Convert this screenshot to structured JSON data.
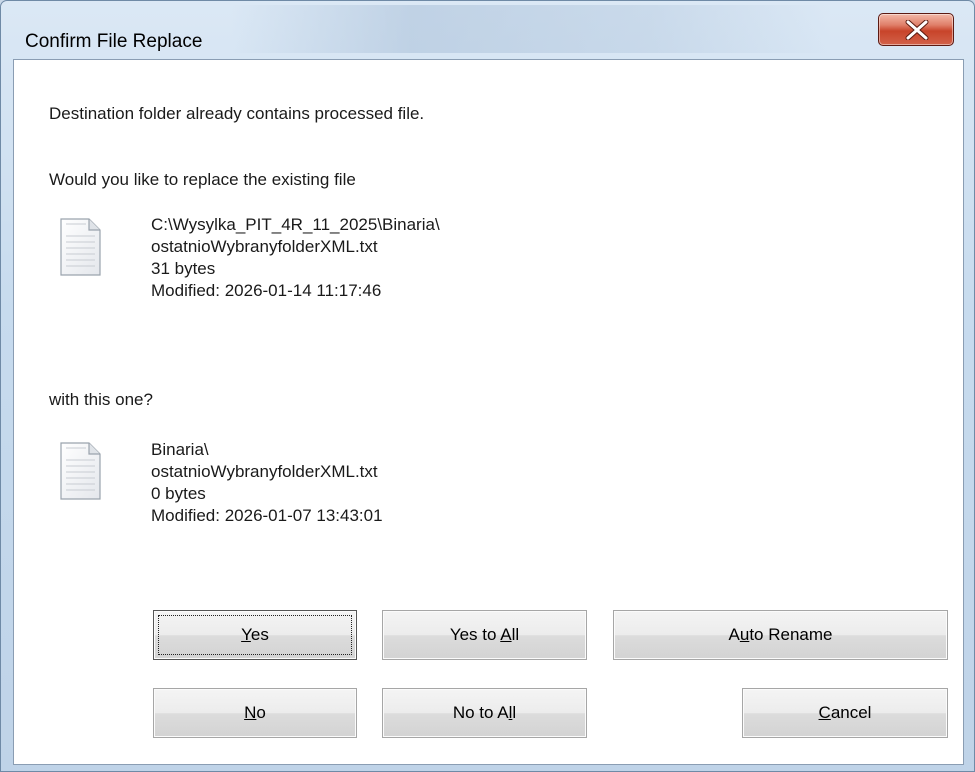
{
  "window": {
    "title": "Confirm File Replace"
  },
  "message": {
    "line1": "Destination folder already contains processed file.",
    "line2": "Would you like to replace the existing file",
    "line3": "with this one?"
  },
  "existing_file": {
    "path": "C:\\Wysylka_PIT_4R_11_2025\\Binaria\\",
    "name": "ostatnioWybranyfolderXML.txt",
    "size": "31 bytes",
    "modified": "Modified: 2026-01-14 11:17:46",
    "icon": "text-file-icon"
  },
  "new_file": {
    "path": "Binaria\\",
    "name": "ostatnioWybranyfolderXML.txt",
    "size": "0 bytes",
    "modified": "Modified: 2026-01-07 13:43:01",
    "icon": "text-file-icon"
  },
  "buttons": {
    "yes": {
      "pre": "",
      "key": "Y",
      "post": "es"
    },
    "yes_to_all": {
      "pre": "Yes to ",
      "key": "A",
      "post": "ll"
    },
    "auto_rename": {
      "pre": "A",
      "key": "u",
      "post": "to Rename"
    },
    "no": {
      "pre": "",
      "key": "N",
      "post": "o"
    },
    "no_to_all": {
      "pre": "No to A",
      "key": "l",
      "post": "l"
    },
    "cancel": {
      "pre": "",
      "key": "C",
      "post": "ancel"
    }
  },
  "icons": {
    "close": "close-icon"
  },
  "colors": {
    "close_button": "#c8442a",
    "titlebar": "#c7dbee"
  }
}
